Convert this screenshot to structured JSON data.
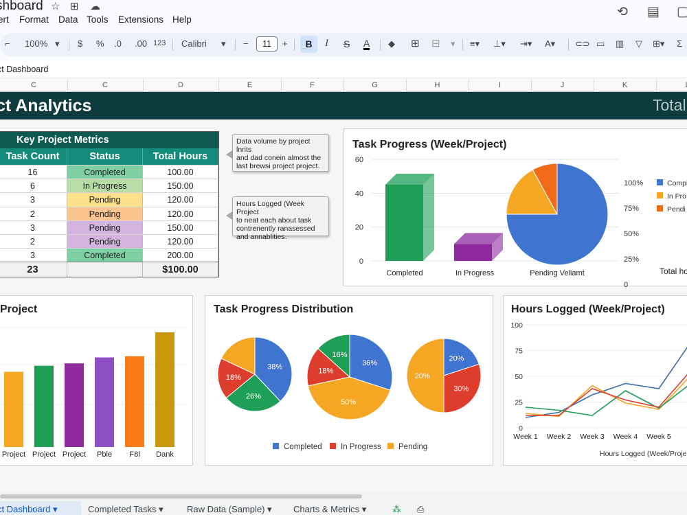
{
  "header": {
    "doc_title": "shboard",
    "menu": [
      "ert",
      "Format",
      "Data",
      "Tools",
      "Extensions",
      "Help"
    ]
  },
  "toolbar": {
    "zoom": "100%",
    "currency": "$",
    "percent": "%",
    "dec_decrease": ".0",
    "dec_increase": ".00",
    "number_format": "123",
    "font": "Calibri",
    "font_size": "11",
    "bold": "B",
    "italic": "I",
    "strike": "S",
    "text_color": "A"
  },
  "namebox": {
    "text": "ct Dashboard"
  },
  "columns": [
    "C",
    "C",
    "D",
    "E",
    "F",
    "G",
    "H",
    "I",
    "J",
    "K",
    "L"
  ],
  "banner": {
    "title": "ct Analytics",
    "right": "Total"
  },
  "metrics": {
    "title": "Key Project Metrics",
    "headers": [
      "Task Count",
      "Status",
      "Total Hours"
    ],
    "rows": [
      {
        "count": "16",
        "status": "Completed",
        "hours": "100.00"
      },
      {
        "count": "6",
        "status": "In Progress",
        "hours": "150.00"
      },
      {
        "count": "3",
        "status": "Pending",
        "hours": "120.00"
      },
      {
        "count": "2",
        "status": "Pending",
        "hours": "120.00"
      },
      {
        "count": "3",
        "status": "Pending",
        "hours": "150.00"
      },
      {
        "count": "2",
        "status": "Pending",
        "hours": "120.00"
      },
      {
        "count": "3",
        "status": "Completed",
        "hours": "200.00"
      }
    ],
    "total_count": "23",
    "total_hours": "$100.00",
    "status_colors": [
      "#7fcfa5",
      "#b7dca6",
      "#fde08b",
      "#f9c48e",
      "#d3b4df",
      "#d3b4df",
      "#7fcfa5"
    ]
  },
  "notes": {
    "note1": [
      "Data volume by project lnrits",
      "and dad conein almost the",
      "last brewsi project project."
    ],
    "note2": [
      "Hours Logged (Week Project",
      "to neat each about task",
      "contrenently ranasessed",
      "and annablities."
    ]
  },
  "cards": {
    "task_progress": "Task Progress (Week/Project)",
    "project": "Project",
    "distribution": "Task Progress Distribution",
    "hours": "Hours Logged (Week/Project)"
  },
  "chart_data": [
    {
      "type": "bar",
      "title": "Task Progress (Week/Project)",
      "categories": [
        "Completed",
        "In Progress",
        "Pending Veliamt"
      ],
      "values": [
        45,
        10
      ],
      "ylim": [
        0,
        60
      ],
      "yticks": [
        "0",
        "20",
        "40",
        "60"
      ],
      "colors": [
        "#1e9e57",
        "#8e2a9e"
      ],
      "pie": {
        "values": [
          75,
          17,
          8
        ],
        "colors": [
          "#3f74d1",
          "#f5a623",
          "#f06a1a"
        ]
      },
      "right_axis": [
        "100%",
        "75%",
        "50%",
        "25%",
        "0"
      ],
      "legend": [
        "Compl",
        "In Pro",
        "Pendi"
      ],
      "legend_colors": [
        "#3f74d1",
        "#f5a623",
        "#f06a1a"
      ],
      "footer": "Total ho"
    },
    {
      "type": "bar",
      "title": "Project",
      "categories": [
        "Project",
        "Project",
        "Project",
        "Pble",
        "F8l",
        "Dank"
      ],
      "values": [
        63,
        68,
        70,
        75,
        76,
        96
      ],
      "ylim": [
        0,
        100
      ],
      "colors": [
        "#f5a623",
        "#1e9e57",
        "#8e2a9e",
        "#8e4fc4",
        "#f97d16",
        "#c9980e"
      ]
    },
    {
      "type": "pie",
      "title": "Task Progress Distribution",
      "pies": [
        {
          "values": [
            38,
            26,
            18,
            18
          ],
          "labels": [
            "38%",
            "26%",
            "18%",
            ""
          ],
          "colors": [
            "#3f74d1",
            "#1e9e57",
            "#dd3d2c",
            "#f5a623"
          ]
        },
        {
          "values": [
            36,
            50,
            18,
            16
          ],
          "labels": [
            "36%",
            "50%",
            "18%",
            "16%"
          ],
          "colors": [
            "#3f74d1",
            "#f5a623",
            "#dd3d2c",
            "#1e9e57"
          ]
        },
        {
          "values": [
            20,
            30,
            50
          ],
          "labels": [
            "20%",
            "30%",
            "20%"
          ],
          "colors": [
            "#3f74d1",
            "#dd3d2c",
            "#f5a623"
          ]
        }
      ],
      "legend": [
        "Completed",
        "In Progress",
        "Pending"
      ],
      "legend_colors": [
        "#3f74d1",
        "#dd3d2c",
        "#f5a623"
      ]
    },
    {
      "type": "line",
      "title": "Hours Logged (Week/Project)",
      "x": [
        "Week 1",
        "Week 2",
        "Week 3",
        "Week 4",
        "Week 5",
        "W"
      ],
      "ylim": [
        0,
        100
      ],
      "yticks": [
        "0",
        "25",
        "50",
        "75",
        "100"
      ],
      "series": [
        {
          "values": [
            10,
            15,
            32,
            43,
            38,
            85
          ],
          "color": "#3a6ea5"
        },
        {
          "values": [
            14,
            11,
            41,
            24,
            18,
            52
          ],
          "color": "#f5a623"
        },
        {
          "values": [
            20,
            17,
            12,
            36,
            19,
            44
          ],
          "color": "#1e9e57"
        },
        {
          "values": [
            12,
            12,
            38,
            27,
            20,
            57
          ],
          "color": "#dd3d2c"
        }
      ],
      "xlabel": "Hours Logged (Week/Projec"
    }
  ],
  "tabs": [
    "ct Dashboard",
    "Completed Tasks",
    "Raw Data (Sample)",
    "Charts & Metrics"
  ]
}
